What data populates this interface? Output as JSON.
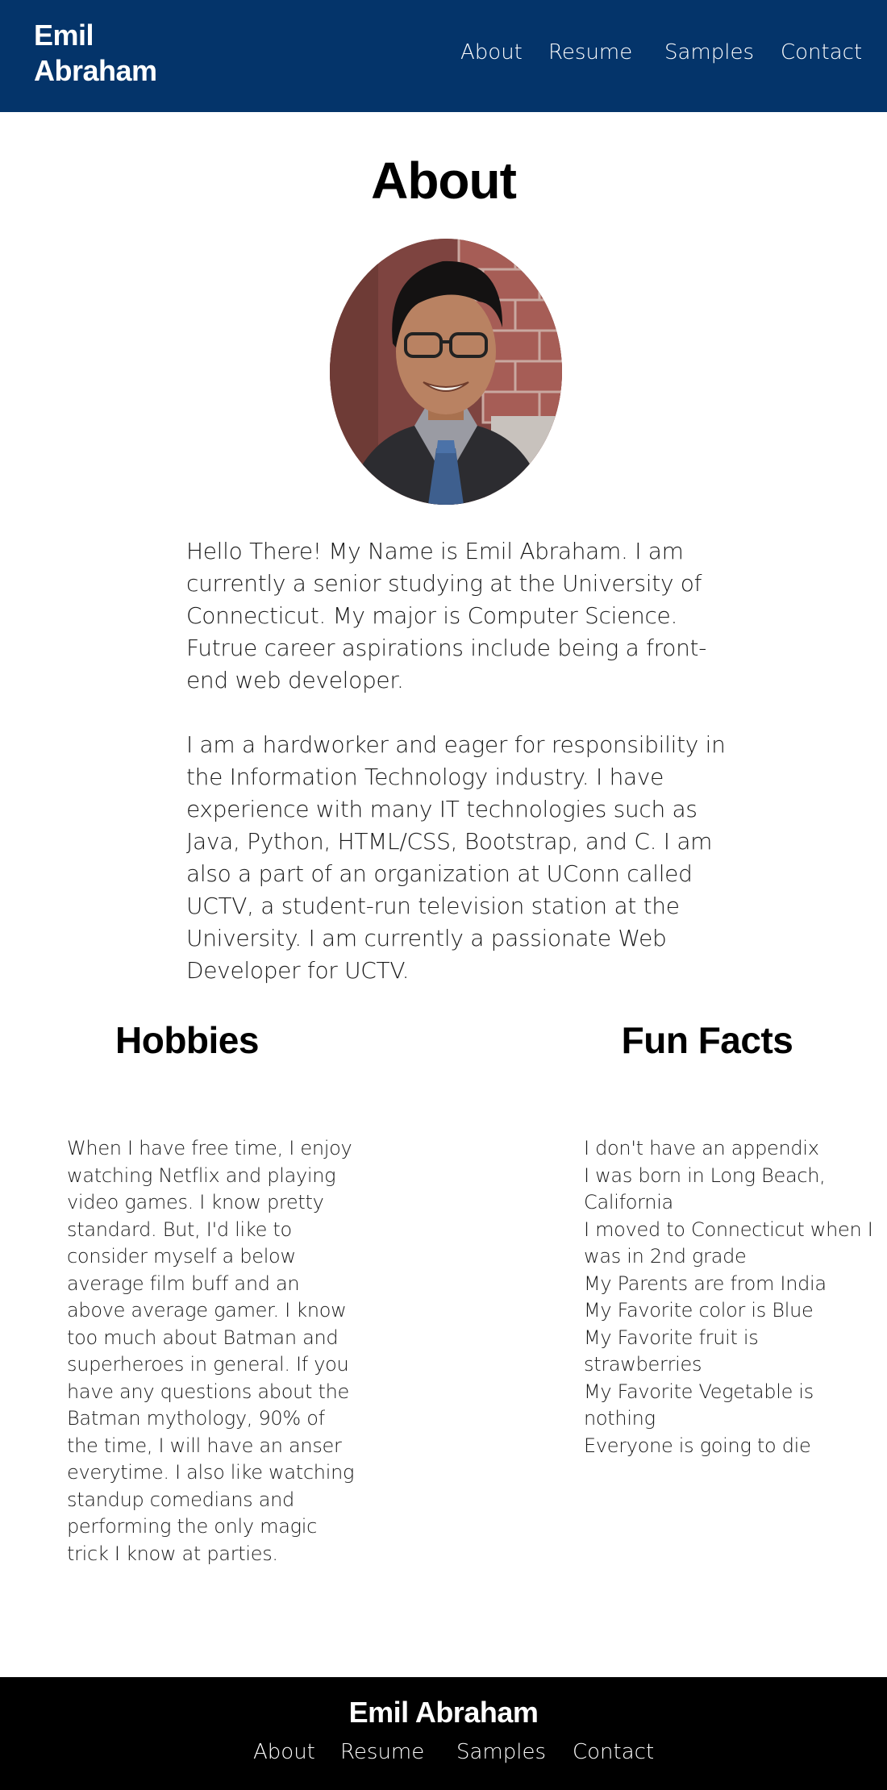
{
  "header": {
    "brand_line1": "Emil",
    "brand_line2": "Abraham",
    "nav": {
      "about": "About",
      "resume": "Resume",
      "samples": "Samples",
      "contact": "Contact"
    }
  },
  "about": {
    "title": "About",
    "portrait_icon": "portrait-photo",
    "paragraph1": "Hello There! My Name is Emil Abraham. I am currently a senior studying at the University of Connecticut. My major is Computer Science. Futrue career aspirations include being a front-end web developer.",
    "paragraph2": "I am a hardworker and eager for responsibility in the Information Technology industry. I have experience with many IT technologies such as Java, Python, HTML/CSS, Bootstrap, and C. I am also a part of an organization at UConn called UCTV, a student-run television station at the University. I am currently a passionate Web Developer for UCTV."
  },
  "hobbies": {
    "heading": "Hobbies",
    "text": "When I have free time, I enjoy watching Netflix and playing video games. I know pretty standard. But, I'd like to consider myself a below average film buff and an above average gamer. I know too much about Batman and superheroes in general. If you have any questions about the Batman mythology, 90% of the time, I will have an anser everytime. I also like watching standup comedians and performing the only magic trick I know at parties."
  },
  "fun_facts": {
    "heading": "Fun Facts",
    "items": [
      "I don't have an appendix",
      "I was born in Long Beach, California",
      "I moved to Connecticut when I was in 2nd grade",
      "My Parents are from India",
      "My Favorite color is Blue",
      "My Favorite fruit is strawberries",
      "My Favorite Vegetable is nothing",
      "Everyone is going to die"
    ]
  },
  "footer": {
    "name": "Emil Abraham",
    "nav": {
      "about": "About",
      "resume": "Resume",
      "samples": "Samples",
      "contact": "Contact"
    }
  },
  "colors": {
    "header_bg": "#04346a",
    "footer_bg": "#000000",
    "text": "#1a1a1a"
  }
}
